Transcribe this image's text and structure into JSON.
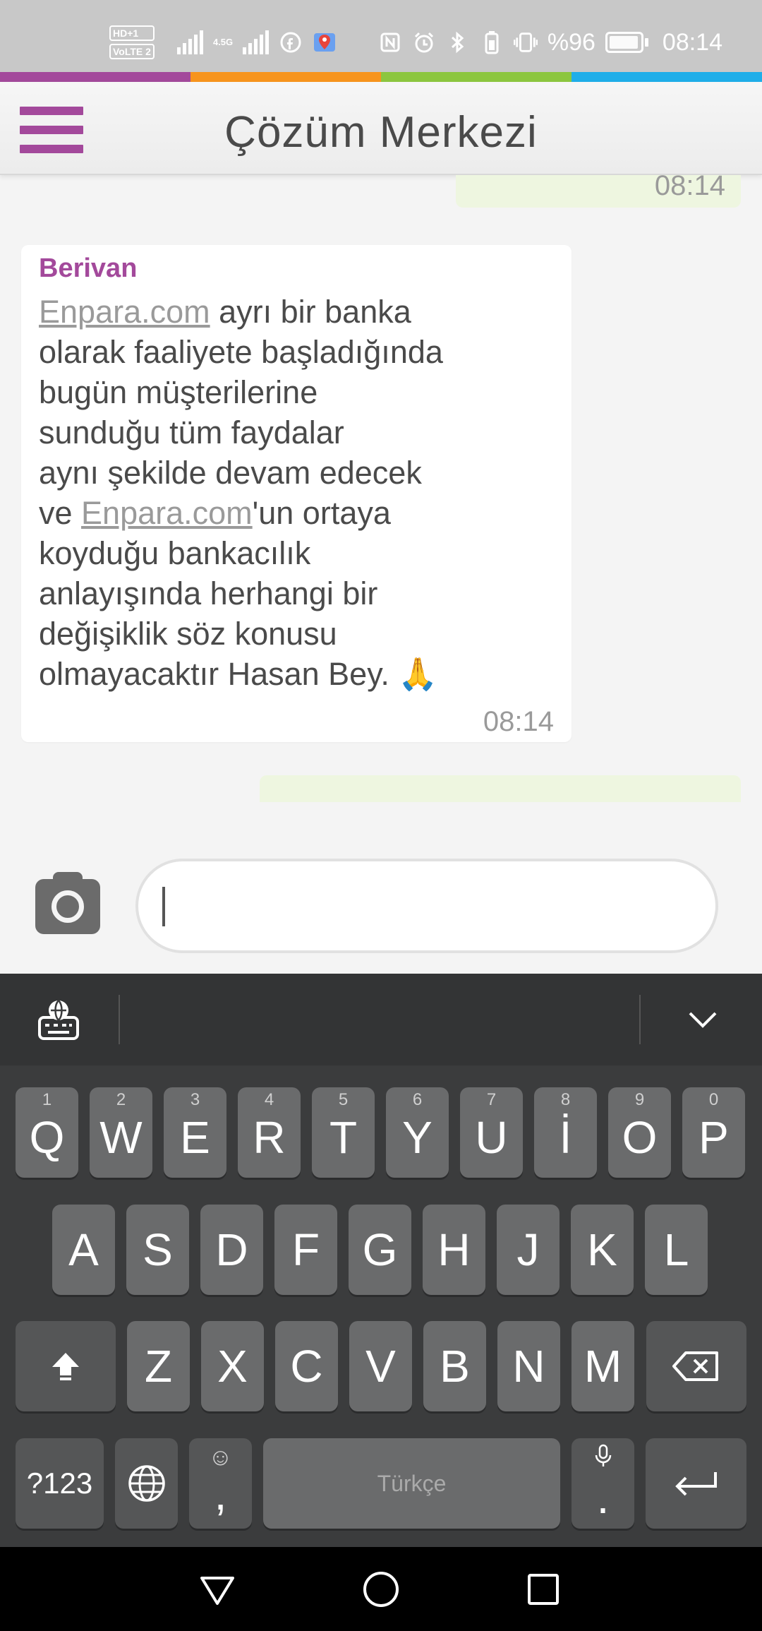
{
  "status_bar": {
    "sim1_badge": "HD+1",
    "sim2_badge": "VoLTE 2",
    "network_label": "4.5G",
    "battery_percent": "%96",
    "time": "08:14",
    "icons": [
      "signal-icon",
      "signal-icon",
      "facebook-icon",
      "maps-icon",
      "nfc-icon",
      "alarm-icon",
      "bluetooth-icon",
      "vibrate-icon",
      "battery-icon"
    ]
  },
  "brand_colors": [
    "#a3499b",
    "#f7941d",
    "#8cc63f",
    "#1faee9"
  ],
  "header": {
    "title": "Çözüm Merkezi"
  },
  "chat": {
    "top_outgoing_time": "08:14",
    "incoming": {
      "sender": "Berivan",
      "lines": [
        {
          "link": "Enpara.com",
          "text": " ayrı bir banka"
        },
        {
          "text": "olarak faaliyete başladığında"
        },
        {
          "text": "bugün müşterilerine"
        },
        {
          "text": "sunduğu tüm faydalar"
        },
        {
          "text": "aynı şekilde devam edecek"
        },
        {
          "prefix": "ve ",
          "link": "Enpara.com",
          "text": "'un ortaya"
        },
        {
          "text": "koyduğu bankacılık"
        },
        {
          "text": "anlayışında herhangi bir"
        },
        {
          "text": "değişiklik söz konusu"
        },
        {
          "text": "olmayacaktır Hasan Bey. 🙏"
        }
      ],
      "time": "08:14"
    }
  },
  "composer": {
    "value": "",
    "placeholder": ""
  },
  "keyboard": {
    "row1": [
      {
        "hint": "1",
        "label": "Q"
      },
      {
        "hint": "2",
        "label": "W"
      },
      {
        "hint": "3",
        "label": "E"
      },
      {
        "hint": "4",
        "label": "R"
      },
      {
        "hint": "5",
        "label": "T"
      },
      {
        "hint": "6",
        "label": "Y"
      },
      {
        "hint": "7",
        "label": "U"
      },
      {
        "hint": "8",
        "label": "İ"
      },
      {
        "hint": "9",
        "label": "O"
      },
      {
        "hint": "0",
        "label": "P"
      }
    ],
    "row2": [
      "A",
      "S",
      "D",
      "F",
      "G",
      "H",
      "J",
      "K",
      "L"
    ],
    "row3": [
      "Z",
      "X",
      "C",
      "V",
      "B",
      "N",
      "M"
    ],
    "symbols_label": "?123",
    "comma_label": ",",
    "space_label": "Türkçe",
    "period_label": ".",
    "emoji_hint": "☺"
  }
}
